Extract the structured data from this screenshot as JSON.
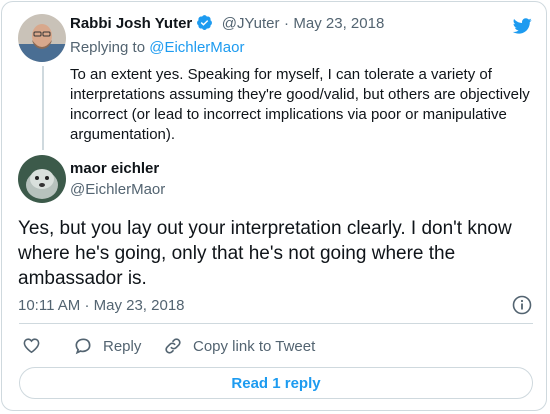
{
  "reply_tweet": {
    "author_name": "Rabbi Josh Yuter",
    "handle": "@JYuter",
    "separator": "·",
    "date": "May 23, 2018",
    "replying_to_prefix": "Replying to",
    "replying_to_handle": "@EichlerMaor",
    "text": "To an extent yes. Speaking for myself, I can tolerate a variety of interpretations assuming they're good/valid, but others are objectively incorrect (or lead to incorrect implications via poor or manipulative argumentation).",
    "verified": true
  },
  "main_tweet": {
    "author_name": "maor eichler",
    "handle": "@EichlerMaor",
    "text": "Yes, but you lay out your interpretation clearly. I don't know where he's going, only that he's not going where the ambassador is.",
    "time": "10:11 AM",
    "separator": "·",
    "date": "May 23, 2018"
  },
  "actions": {
    "like_icon": "heart-icon",
    "reply_label": "Reply",
    "copy_link_label": "Copy link to Tweet"
  },
  "read_replies_label": "Read 1 reply",
  "icons": [
    "twitter-bird-icon",
    "verified-badge-icon",
    "info-icon",
    "heart-icon",
    "reply-icon",
    "link-icon"
  ],
  "colors": {
    "accent": "#1d9bf0",
    "muted_text": "#536471",
    "border": "#cfd9de",
    "main_text": "#0f1419"
  }
}
